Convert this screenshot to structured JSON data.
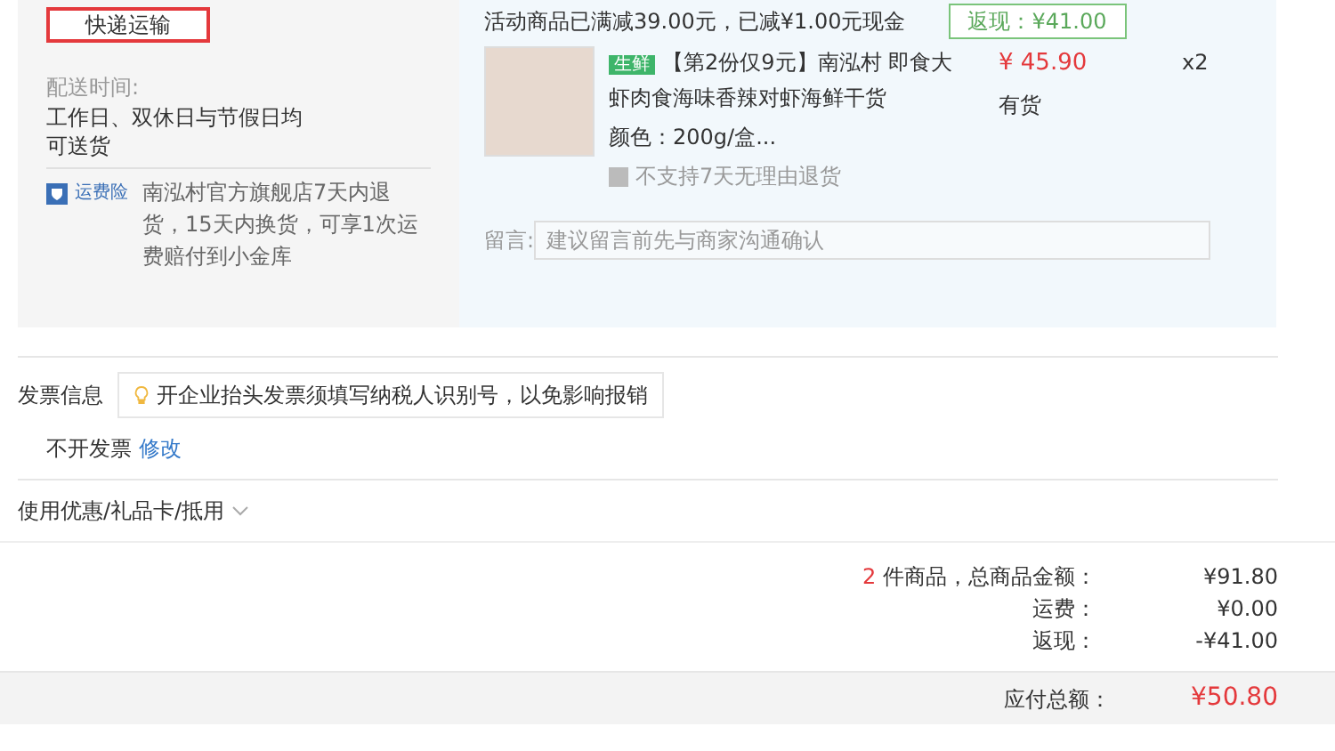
{
  "shipping": {
    "method_button": "快递运输",
    "delivery_label": "配送时间:",
    "delivery_text": "工作日、双休日与节假日均可送货",
    "insurance_badge": "运费险",
    "insurance_text": "南泓村官方旗舰店7天内退货，15天内换货，可享1次运费赔付到小金库"
  },
  "promo": {
    "text": "活动商品已满减39.00元，已减¥1.00元现金",
    "rebate_tag": "返现：¥41.00"
  },
  "items": [
    {
      "tag": "生鲜",
      "title": "【第2份仅9元】南泓村 即食大虾肉食海味香辣对虾海鲜干货",
      "spec": "颜色：200g/盒...",
      "return_policy": "不支持7天无理由退货",
      "price": "¥ 45.90",
      "stock": "有货",
      "quantity": "x2"
    }
  ],
  "message": {
    "label": "留言:",
    "placeholder": "建议留言前先与商家沟通确认"
  },
  "invoice": {
    "label": "发票信息",
    "tip": "开企业抬头发票须填写纳税人识别号，以免影响报销",
    "value": "不开发票",
    "edit_link": "修改"
  },
  "coupons": {
    "label": "使用优惠/礼品卡/抵用",
    "expanded": false
  },
  "summary": {
    "count": "2",
    "count_text": " 件商品，总商品金额：",
    "subtotal": "¥91.80",
    "rows": [
      {
        "label": "运费：",
        "value": "¥0.00"
      },
      {
        "label": "返现：",
        "value": "-¥41.00"
      }
    ],
    "total_label": "应付总额：",
    "total": "¥50.80"
  }
}
